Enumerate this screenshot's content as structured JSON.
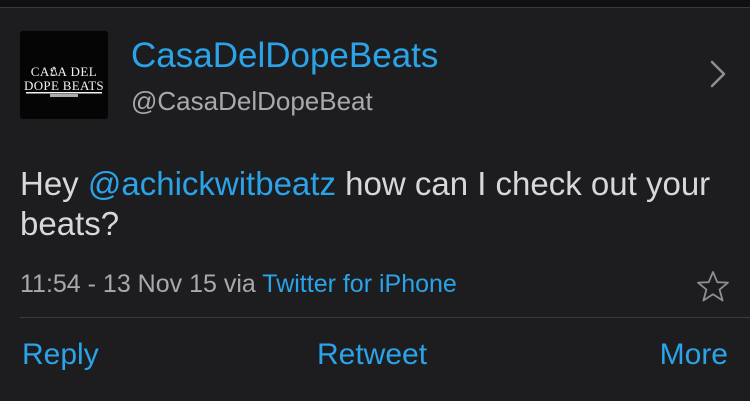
{
  "profile": {
    "avatar_text_line1": "CASA DEL",
    "avatar_text_line2": "DOPE BEATS",
    "display_name": "CasaDelDopeBeats",
    "handle": "@CasaDelDopeBeat"
  },
  "tweet": {
    "text_before": "Hey ",
    "mention": "@achickwitbeatz",
    "text_after": " how can I check out your beats?",
    "timestamp": "11:54 - 13 Nov 15",
    "via_label": " via ",
    "client": "Twitter for iPhone"
  },
  "actions": {
    "reply": "Reply",
    "retweet": "Retweet",
    "more": "More"
  },
  "icons": {
    "chevron": "chevron-right-icon",
    "star": "star-outline-icon"
  },
  "colors": {
    "accent": "#2aa3e8",
    "background": "#1d1d1f",
    "text": "#d8d8da",
    "secondary": "#a9a9ad"
  }
}
